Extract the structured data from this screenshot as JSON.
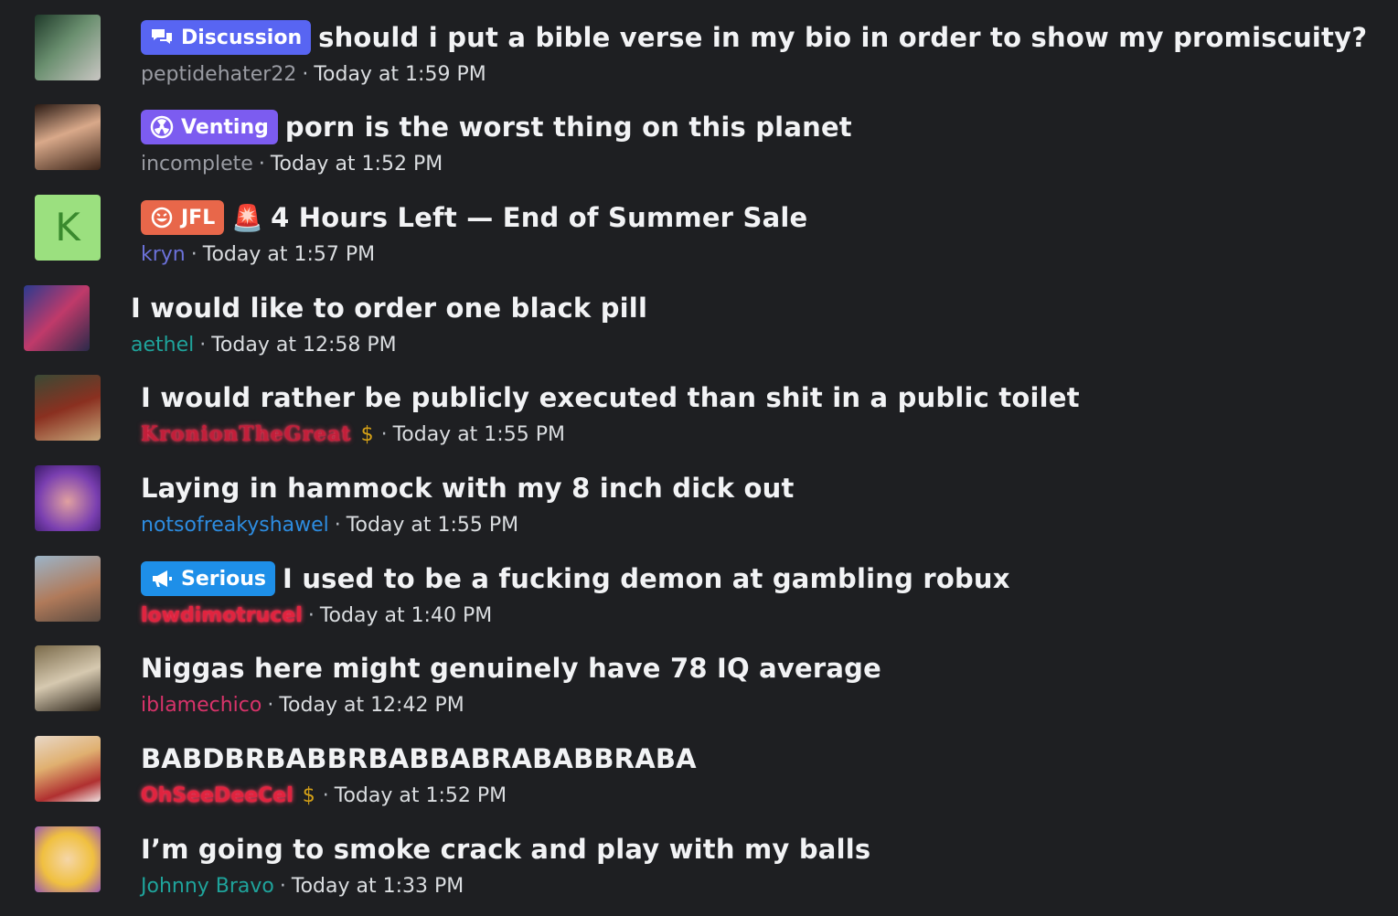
{
  "colors": {
    "background": "#1e1f22",
    "discussion": "#5865f2",
    "venting": "#7c5cf0",
    "jfl": "#e8674a",
    "serious": "#1e8fe8"
  },
  "threads": [
    {
      "tag": "Discussion",
      "tag_icon": "chat-bubbles-icon",
      "title": "should i put a bible verse in my bio in order to show my promiscuity?",
      "author": "peptidehater22",
      "author_color": "#9a9ca3",
      "time": "Today at 1:59 PM"
    },
    {
      "tag": "Venting",
      "tag_icon": "radiation-icon",
      "title": "porn is the worst thing on this planet",
      "author": "incomplete",
      "author_color": "#9a9ca3",
      "time": "Today at 1:52 PM"
    },
    {
      "tag": "JFL",
      "tag_icon": "laughing-face-icon",
      "emoji": "🚨",
      "title": "4 Hours Left — End of Summer Sale",
      "author": "kryn",
      "author_color": "#6b71d9",
      "avatar_letter": "K",
      "time": "Today at 1:57 PM"
    },
    {
      "title": "I would like to order one black pill",
      "author": "aethel",
      "author_color": "#1fa39b",
      "time": "Today at 12:58 PM"
    },
    {
      "title": "I would rather be publicly executed than shit in a public toilet",
      "author": "KronionTheGreat",
      "author_color": "#c21f3a",
      "author_badge": "$",
      "time": "Today at 1:55 PM"
    },
    {
      "title": "Laying in hammock with my 8 inch dick out",
      "author": "notsofreakyshawel",
      "author_color": "#2d8ce0",
      "time": "Today at 1:55 PM"
    },
    {
      "tag": "Serious",
      "tag_icon": "megaphone-icon",
      "title": "I used to be a fucking demon at gambling robux",
      "author": "lowdimotrucel",
      "author_color": "#e0243f",
      "time": "Today at 1:40 PM"
    },
    {
      "title": "Niggas here might genuinely have 78 IQ average",
      "author": "iblamechico",
      "author_color": "#d8336a",
      "time": "Today at 12:42 PM"
    },
    {
      "title": "BABDBRBABBRBABBABRABABBRABA",
      "author": "OhSeeDeeCel",
      "author_color": "#e0243f",
      "author_badge": "$",
      "time": "Today at 1:52 PM"
    },
    {
      "title": "I’m going to smoke crack and play with my balls",
      "author": "Johnny Bravo",
      "author_color": "#1fa39b",
      "time": "Today at 1:33 PM"
    }
  ]
}
